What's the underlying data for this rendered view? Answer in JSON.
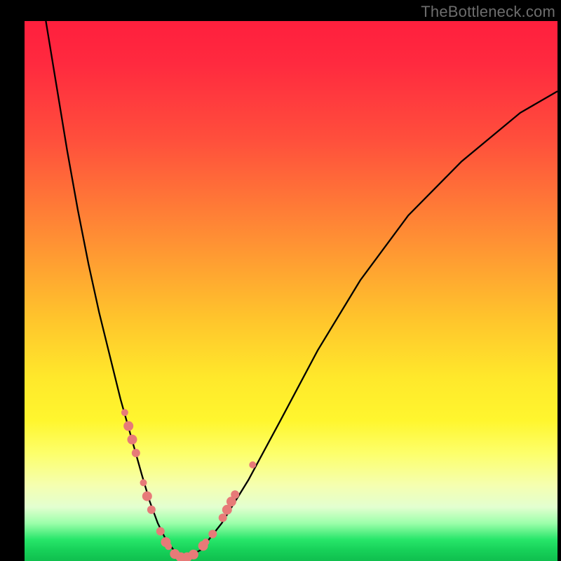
{
  "watermark": "TheBottleneck.com",
  "chart_data": {
    "type": "line",
    "title": "",
    "xlabel": "",
    "ylabel": "",
    "xlim": [
      0,
      100
    ],
    "ylim": [
      0,
      100
    ],
    "series": [
      {
        "name": "bottleneck-curve",
        "x": [
          4,
          6,
          8,
          10,
          12,
          14,
          16,
          18,
          20,
          22,
          23.5,
          25,
          26.5,
          28,
          30,
          33,
          37,
          42,
          48,
          55,
          63,
          72,
          82,
          93,
          100
        ],
        "y": [
          100,
          88,
          76,
          65,
          55,
          46,
          38,
          30,
          23,
          16,
          11,
          7,
          4,
          2,
          0.5,
          2,
          7,
          15,
          26,
          39,
          52,
          64,
          74,
          83,
          87
        ]
      }
    ],
    "markers": {
      "name": "highlighted-points",
      "color": "#e77a78",
      "points": [
        {
          "x": 18.8,
          "y": 27.5,
          "r": 5
        },
        {
          "x": 19.5,
          "y": 25.0,
          "r": 7
        },
        {
          "x": 20.2,
          "y": 22.5,
          "r": 7
        },
        {
          "x": 20.9,
          "y": 20.0,
          "r": 6
        },
        {
          "x": 22.3,
          "y": 14.5,
          "r": 5
        },
        {
          "x": 23.0,
          "y": 12.0,
          "r": 7
        },
        {
          "x": 23.8,
          "y": 9.5,
          "r": 6
        },
        {
          "x": 25.5,
          "y": 5.5,
          "r": 6
        },
        {
          "x": 26.5,
          "y": 3.5,
          "r": 7
        },
        {
          "x": 27.0,
          "y": 2.7,
          "r": 5
        },
        {
          "x": 28.2,
          "y": 1.3,
          "r": 7
        },
        {
          "x": 29.3,
          "y": 0.7,
          "r": 7
        },
        {
          "x": 30.5,
          "y": 0.7,
          "r": 7
        },
        {
          "x": 31.7,
          "y": 1.2,
          "r": 7
        },
        {
          "x": 33.5,
          "y": 2.8,
          "r": 7
        },
        {
          "x": 34.0,
          "y": 3.5,
          "r": 5
        },
        {
          "x": 35.3,
          "y": 5.0,
          "r": 6
        },
        {
          "x": 37.2,
          "y": 8.0,
          "r": 6
        },
        {
          "x": 38.0,
          "y": 9.5,
          "r": 7
        },
        {
          "x": 38.8,
          "y": 11.0,
          "r": 7
        },
        {
          "x": 39.5,
          "y": 12.3,
          "r": 6
        },
        {
          "x": 42.8,
          "y": 17.8,
          "r": 5
        }
      ]
    }
  }
}
